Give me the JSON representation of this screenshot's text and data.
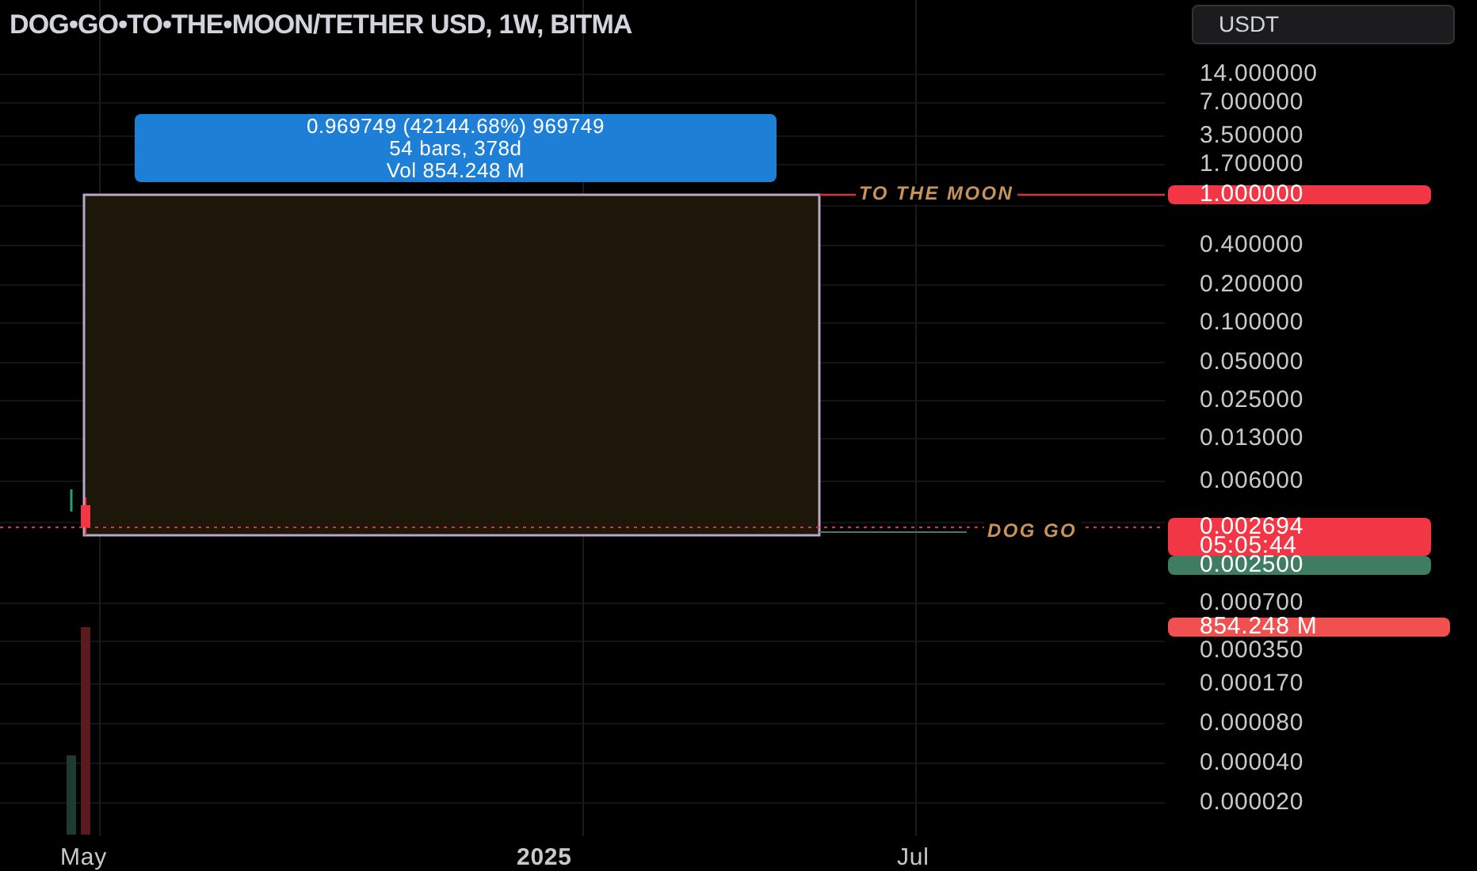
{
  "title": "DOG•GO•TO•THE•MOON/TETHER USD, 1W, BITMA",
  "currency_button": "USDT",
  "price_axis": [
    "14.000000",
    "7.000000",
    "3.500000",
    "1.700000",
    "0.400000",
    "0.200000",
    "0.100000",
    "0.050000",
    "0.025000",
    "0.013000",
    "0.006000",
    "0.000700",
    "0.000350",
    "0.000170",
    "0.000080",
    "0.000040",
    "0.000020"
  ],
  "price_tags": [
    {
      "kind": "sell",
      "lines": [
        "1.000000"
      ]
    },
    {
      "kind": "sell",
      "lines": [
        "0.002694",
        "05:05:44"
      ]
    },
    {
      "kind": "buy",
      "lines": [
        "0.002500"
      ]
    },
    {
      "kind": "volume",
      "lines": [
        "854.248 M"
      ]
    }
  ],
  "measure": {
    "lines": [
      "0.969749 (42144.68%) 969749",
      "54 bars, 378d",
      "Vol 854.248 M"
    ]
  },
  "line_labels": [
    "TO THE MOON",
    "DOG GO"
  ],
  "time_axis": [
    {
      "label": "May",
      "major": false
    },
    {
      "label": "2025",
      "major": true
    },
    {
      "label": "Jul",
      "major": false
    }
  ]
}
